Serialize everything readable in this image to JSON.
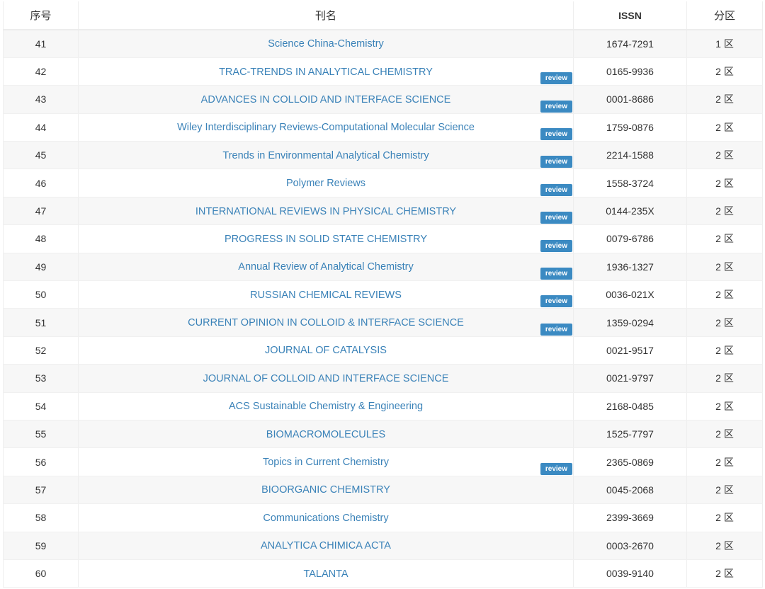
{
  "table": {
    "headers": {
      "no": "序号",
      "name": "刊名",
      "issn": "ISSN",
      "zone": "分区"
    },
    "badge_label": "review",
    "rows": [
      {
        "no": "41",
        "name": "Science China-Chemistry",
        "issn": "1674-7291",
        "zone": "1 区",
        "review": false
      },
      {
        "no": "42",
        "name": "TRAC-TRENDS IN ANALYTICAL CHEMISTRY",
        "issn": "0165-9936",
        "zone": "2 区",
        "review": true
      },
      {
        "no": "43",
        "name": "ADVANCES IN COLLOID AND INTERFACE SCIENCE",
        "issn": "0001-8686",
        "zone": "2 区",
        "review": true
      },
      {
        "no": "44",
        "name": "Wiley Interdisciplinary Reviews-Computational Molecular Science",
        "issn": "1759-0876",
        "zone": "2 区",
        "review": true
      },
      {
        "no": "45",
        "name": "Trends in Environmental Analytical Chemistry",
        "issn": "2214-1588",
        "zone": "2 区",
        "review": true
      },
      {
        "no": "46",
        "name": "Polymer Reviews",
        "issn": "1558-3724",
        "zone": "2 区",
        "review": true
      },
      {
        "no": "47",
        "name": "INTERNATIONAL REVIEWS IN PHYSICAL CHEMISTRY",
        "issn": "0144-235X",
        "zone": "2 区",
        "review": true
      },
      {
        "no": "48",
        "name": "PROGRESS IN SOLID STATE CHEMISTRY",
        "issn": "0079-6786",
        "zone": "2 区",
        "review": true
      },
      {
        "no": "49",
        "name": "Annual Review of Analytical Chemistry",
        "issn": "1936-1327",
        "zone": "2 区",
        "review": true
      },
      {
        "no": "50",
        "name": "RUSSIAN CHEMICAL REVIEWS",
        "issn": "0036-021X",
        "zone": "2 区",
        "review": true
      },
      {
        "no": "51",
        "name": "CURRENT OPINION IN COLLOID & INTERFACE SCIENCE",
        "issn": "1359-0294",
        "zone": "2 区",
        "review": true
      },
      {
        "no": "52",
        "name": "JOURNAL OF CATALYSIS",
        "issn": "0021-9517",
        "zone": "2 区",
        "review": false
      },
      {
        "no": "53",
        "name": "JOURNAL OF COLLOID AND INTERFACE SCIENCE",
        "issn": "0021-9797",
        "zone": "2 区",
        "review": false
      },
      {
        "no": "54",
        "name": "ACS Sustainable Chemistry & Engineering",
        "issn": "2168-0485",
        "zone": "2 区",
        "review": false
      },
      {
        "no": "55",
        "name": "BIOMACROMOLECULES",
        "issn": "1525-7797",
        "zone": "2 区",
        "review": false
      },
      {
        "no": "56",
        "name": "Topics in Current Chemistry",
        "issn": "2365-0869",
        "zone": "2 区",
        "review": true
      },
      {
        "no": "57",
        "name": "BIOORGANIC CHEMISTRY",
        "issn": "0045-2068",
        "zone": "2 区",
        "review": false
      },
      {
        "no": "58",
        "name": "Communications Chemistry",
        "issn": "2399-3669",
        "zone": "2 区",
        "review": false
      },
      {
        "no": "59",
        "name": "ANALYTICA CHIMICA ACTA",
        "issn": "0003-2670",
        "zone": "2 区",
        "review": false
      },
      {
        "no": "60",
        "name": "TALANTA",
        "issn": "0039-9140",
        "zone": "2 区",
        "review": false
      }
    ]
  },
  "colors": {
    "link": "#3a82b8",
    "badge_bg": "#3b8ac2",
    "row_stripe": "#f7f7f7"
  }
}
